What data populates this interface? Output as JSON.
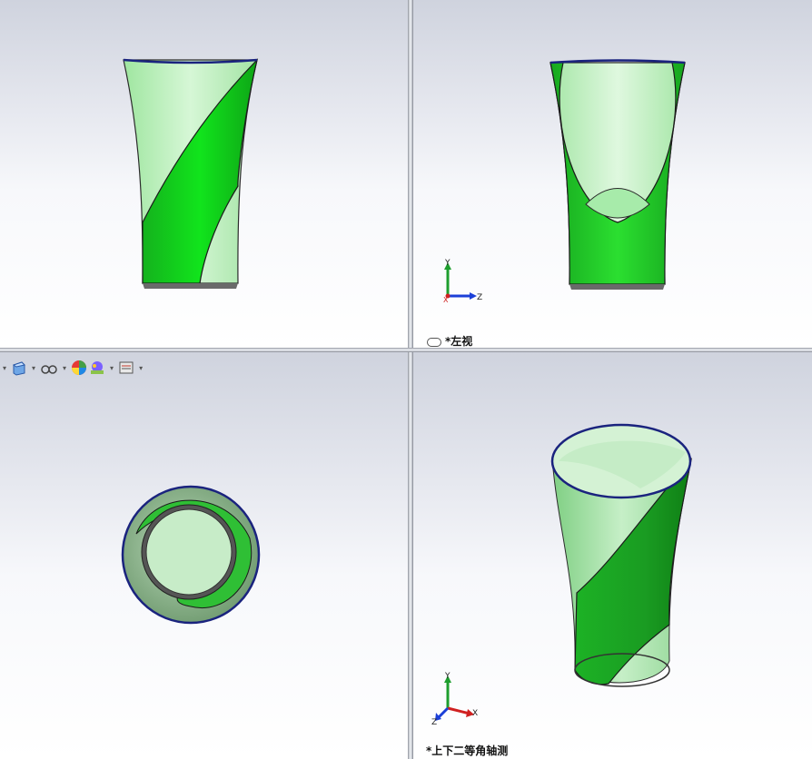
{
  "viewports": {
    "top_right": {
      "label": "*左视"
    },
    "bottom_right": {
      "label": "*上下二等角轴测"
    }
  },
  "triad": {
    "left_view": {
      "vertical": "Y",
      "horizontal": "Z",
      "tail": "X"
    },
    "iso_view": {
      "vertical": "Y",
      "horizontal": "X",
      "depth": "Z"
    }
  },
  "colors": {
    "model_green": "#22c52a",
    "model_light": "#b6efb8",
    "edge_blue": "#1a237e",
    "axis_y": "#1e9e2e",
    "axis_x": "#d02020",
    "axis_z": "#1b3fd8"
  },
  "toolbar": {
    "icons": [
      "display-style-icon",
      "hide-show-icon",
      "edit-appearance-icon",
      "apply-scene-icon",
      "view-settings-icon"
    ]
  }
}
